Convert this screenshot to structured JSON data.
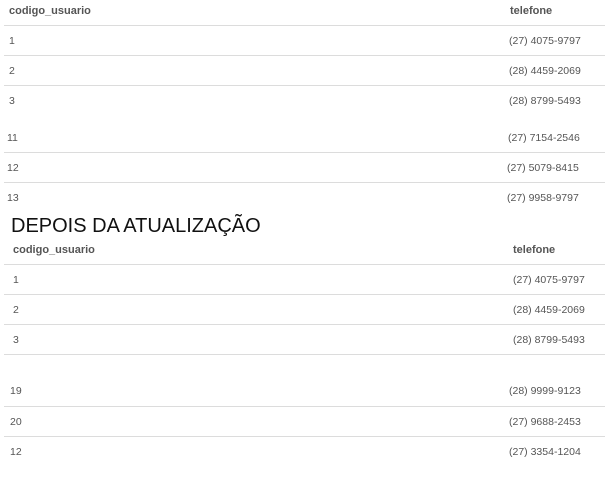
{
  "table_before": {
    "headers": [
      "codigo_usuario",
      "telefone"
    ],
    "rows": [
      [
        "1",
        "(27) 4075-9797"
      ],
      [
        "2",
        "(28) 4459-2069"
      ],
      [
        "3",
        "(28) 8799-5493"
      ],
      [
        "11",
        "(27) 7154-2546"
      ],
      [
        "12",
        "(27) 5079-8415"
      ],
      [
        "13",
        "(27) 9958-9797"
      ]
    ]
  },
  "section_heading": "DEPOIS DA ATUALIZAÇÃO",
  "table_after": {
    "headers": [
      "codigo_usuario",
      "telefone"
    ],
    "rows": [
      [
        "1",
        "(27) 4075-9797"
      ],
      [
        "2",
        "(28) 4459-2069"
      ],
      [
        "3",
        "(28) 8799-5493"
      ],
      [
        "19",
        "(28) 9999-9123"
      ],
      [
        "20",
        "(27) 9688-2453"
      ],
      [
        "12",
        "(27) 3354-1204"
      ]
    ]
  }
}
